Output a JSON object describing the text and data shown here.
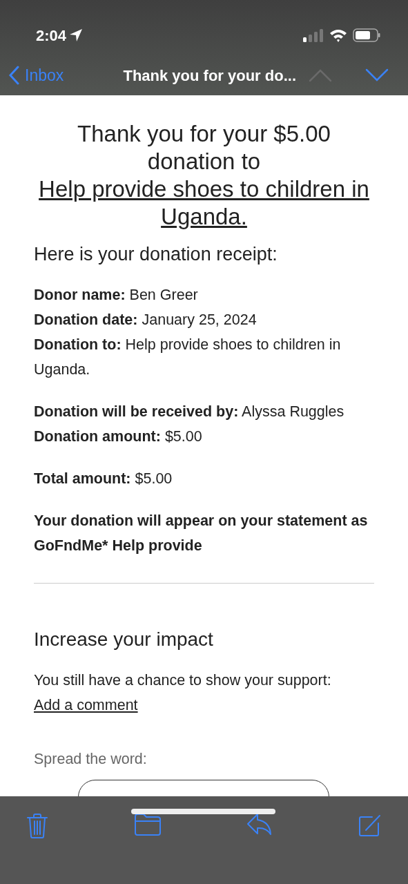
{
  "status_bar": {
    "time": "2:04"
  },
  "nav": {
    "back": "Inbox",
    "title": "Thank you for your do...",
    "previous_disabled": true,
    "next_disabled": false
  },
  "email": {
    "heading": "Thank you for your $5.00 donation to",
    "heading_link": "Help provide shoes to children in Uganda.",
    "intro": "Here is your donation receipt:",
    "receipt_groups": [
      [
        "**Donor name:** Ben Greer",
        "**Donation date:** January 25, 2024",
        "**Donation to:** Help provide shoes to children in Uganda."
      ],
      [
        "**Donation will be received by:** Alyssa Ruggles",
        "**Donation amount:** $5.00"
      ],
      [
        "**Total amount:** $5.00"
      ]
    ],
    "statement": "Your donation will appear on your statement as GoFndMe* Help provide",
    "impact": {
      "title": "Increase your impact",
      "text": "You still have a chance to show your support:",
      "link": "Add a comment",
      "spread": "Spread the word:"
    }
  }
}
